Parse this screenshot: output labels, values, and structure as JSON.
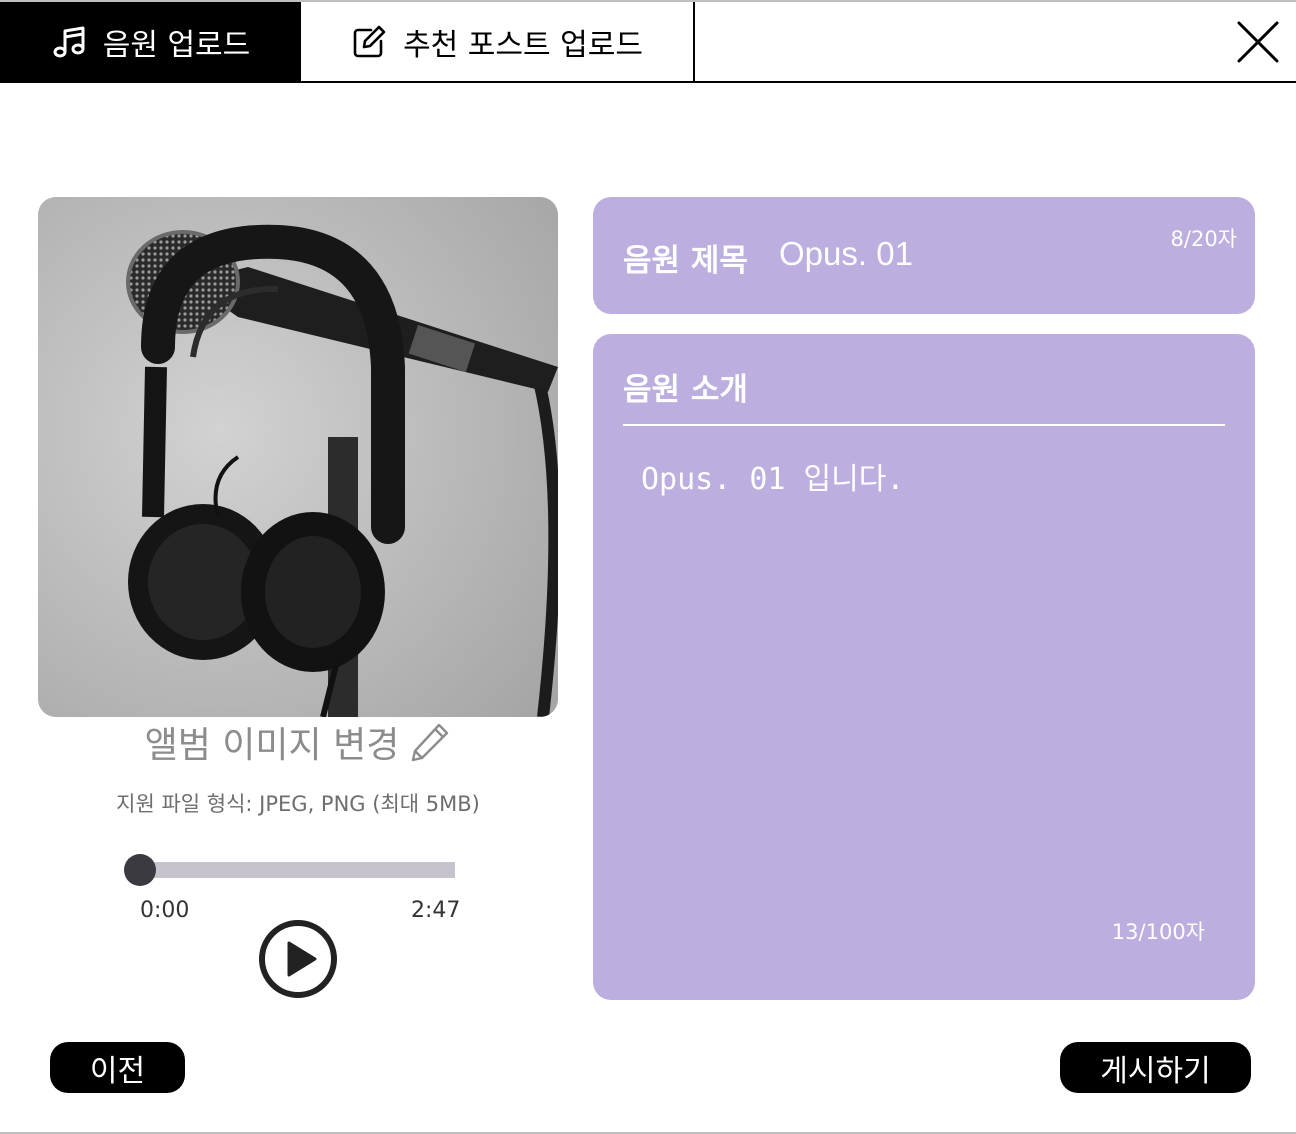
{
  "tabs": [
    {
      "label": "음원 업로드",
      "icon": "music-note-icon",
      "active": true
    },
    {
      "label": "추천 포스트 업로드",
      "icon": "edit-icon",
      "active": false
    }
  ],
  "close_icon": "close-icon",
  "album": {
    "image_alt": "microphone with headphones",
    "change_label": "앨범 이미지 변경",
    "change_icon": "pencil-icon",
    "file_hint": "지원 파일 형식: JPEG, PNG (최대 5MB)"
  },
  "player": {
    "current_time": "0:00",
    "duration": "2:47",
    "progress": 0,
    "play_icon": "play-icon"
  },
  "title_field": {
    "label": "음원 제목",
    "value": "Opus. 01",
    "count": "8/20자"
  },
  "intro_field": {
    "label": "음원 소개",
    "value": "Opus. 01 입니다.",
    "count": "13/100자"
  },
  "buttons": {
    "prev": "이전",
    "post": "게시하기"
  },
  "colors": {
    "panel": "#bcaede",
    "active_tab": "#000000",
    "button": "#000000"
  }
}
